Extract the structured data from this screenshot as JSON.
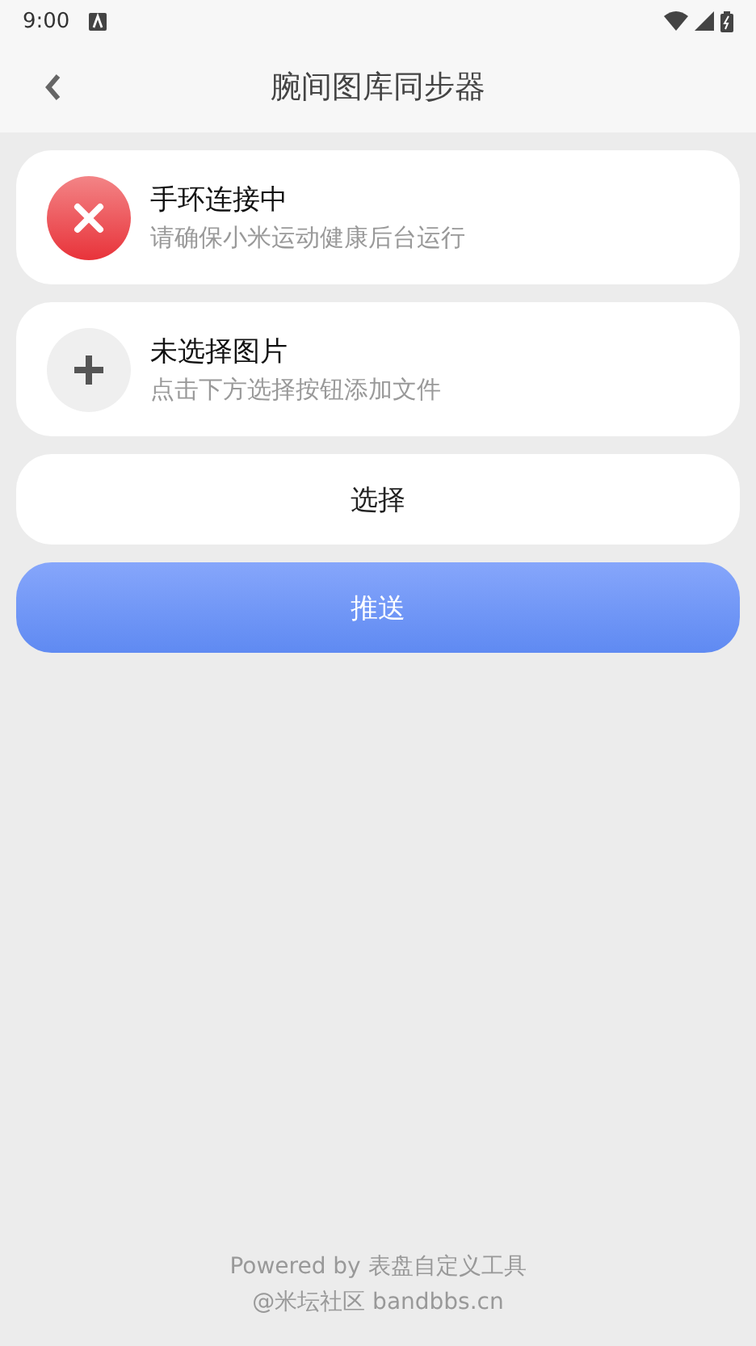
{
  "status_bar": {
    "time": "9:00"
  },
  "app_bar": {
    "title": "腕间图库同步器"
  },
  "status_cards": [
    {
      "kind": "error",
      "title": "手环连接中",
      "subtitle": "请确保小米运动健康后台运行"
    },
    {
      "kind": "add",
      "title": "未选择图片",
      "subtitle": "点击下方选择按钮添加文件"
    }
  ],
  "buttons": [
    {
      "kind": "secondary",
      "label": "选择"
    },
    {
      "kind": "primary",
      "label": "推送"
    }
  ],
  "footer": {
    "lines": [
      "Powered by 表盘自定义工具",
      "@米坛社区 bandbbs.cn"
    ]
  }
}
